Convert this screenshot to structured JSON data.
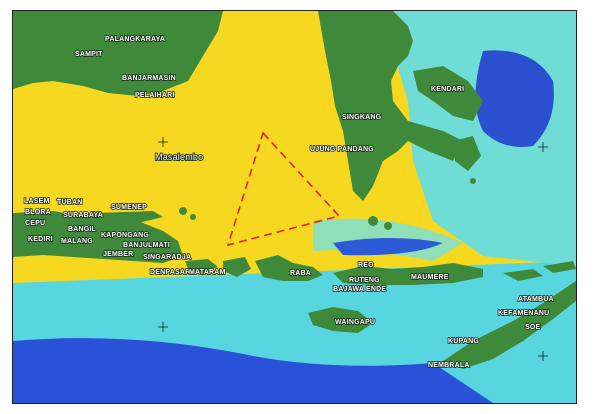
{
  "map": {
    "title": "",
    "colors": {
      "deep_sea": "#1e3fd0",
      "mid_sea": "#35c8e8",
      "shallow_sea": "#f6d820",
      "land": "#3f8a3a",
      "route": "#e8201a"
    },
    "place_labels": [
      {
        "id": "palangkaraya",
        "text": "PALANGKARAYA"
      },
      {
        "id": "sampit",
        "text": "SAMPIT"
      },
      {
        "id": "banjarmasin",
        "text": "BANJARMASIN"
      },
      {
        "id": "pelaihari",
        "text": "PELAIHARI"
      },
      {
        "id": "masalembo",
        "text": "Masalembo"
      },
      {
        "id": "singkang",
        "text": "SINGKANG"
      },
      {
        "id": "ujung-pandang",
        "text": "UJUNG PANDANG"
      },
      {
        "id": "kendari",
        "text": "KENDARI"
      },
      {
        "id": "lasem",
        "text": "LASEM"
      },
      {
        "id": "tuban",
        "text": "TUBAN"
      },
      {
        "id": "blora",
        "text": "BLORA"
      },
      {
        "id": "cepu",
        "text": "CEPU"
      },
      {
        "id": "surabaya",
        "text": "SURABAYA"
      },
      {
        "id": "sumenep",
        "text": "SUMENEP"
      },
      {
        "id": "bangil",
        "text": "BANGIL"
      },
      {
        "id": "kediri",
        "text": "KEDIRI"
      },
      {
        "id": "malang",
        "text": "MALANG"
      },
      {
        "id": "kapongang",
        "text": "KAPONGANG"
      },
      {
        "id": "banjulmati",
        "text": "BANJULMATI"
      },
      {
        "id": "jember",
        "text": "JEMBER"
      },
      {
        "id": "singaradja",
        "text": "SINGARADJA"
      },
      {
        "id": "denpasar",
        "text": "DENPASAR"
      },
      {
        "id": "mataram",
        "text": "MATARAM"
      },
      {
        "id": "raba",
        "text": "RABA"
      },
      {
        "id": "reo",
        "text": "REO"
      },
      {
        "id": "ruteng",
        "text": "RUTENG"
      },
      {
        "id": "bajawa-ende",
        "text": "BAJAWA ENDE"
      },
      {
        "id": "maumere",
        "text": "MAUMERE"
      },
      {
        "id": "waingapu",
        "text": "WAINGAPU"
      },
      {
        "id": "atambua",
        "text": "ATAMBUA"
      },
      {
        "id": "kefamenanu",
        "text": "KEFAMENANU"
      },
      {
        "id": "soe",
        "text": "SOE"
      },
      {
        "id": "kupang",
        "text": "KUPANG"
      },
      {
        "id": "nembrala",
        "text": "NEMBRALA"
      }
    ]
  }
}
